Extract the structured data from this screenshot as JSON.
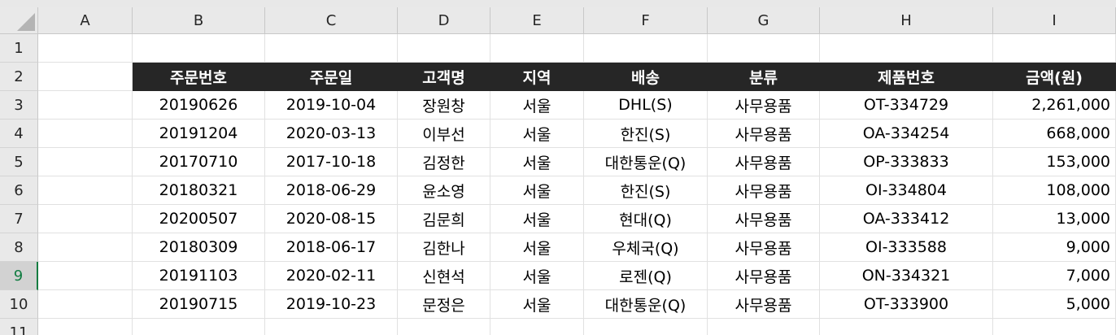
{
  "columns": [
    "A",
    "B",
    "C",
    "D",
    "E",
    "F",
    "G",
    "H",
    "I"
  ],
  "rows": [
    "1",
    "2",
    "3",
    "4",
    "5",
    "6",
    "7",
    "8",
    "9",
    "10",
    "11"
  ],
  "active_row": "9",
  "table": {
    "headers": [
      "주문번호",
      "주문일",
      "고객명",
      "지역",
      "배송",
      "분류",
      "제품번호",
      "금액(원)"
    ],
    "records": [
      [
        "20190626",
        "2019-10-04",
        "장원창",
        "서울",
        "DHL(S)",
        "사무용품",
        "OT-334729",
        "2,261,000"
      ],
      [
        "20191204",
        "2020-03-13",
        "이부선",
        "서울",
        "한진(S)",
        "사무용품",
        "OA-334254",
        "668,000"
      ],
      [
        "20170710",
        "2017-10-18",
        "김정한",
        "서울",
        "대한통운(Q)",
        "사무용품",
        "OP-333833",
        "153,000"
      ],
      [
        "20180321",
        "2018-06-29",
        "윤소영",
        "서울",
        "한진(S)",
        "사무용품",
        "OI-334804",
        "108,000"
      ],
      [
        "20200507",
        "2020-08-15",
        "김문희",
        "서울",
        "현대(Q)",
        "사무용품",
        "OA-333412",
        "13,000"
      ],
      [
        "20180309",
        "2018-06-17",
        "김한나",
        "서울",
        "우체국(Q)",
        "사무용품",
        "OI-333588",
        "9,000"
      ],
      [
        "20191103",
        "2020-02-11",
        "신현석",
        "서울",
        "로젠(Q)",
        "사무용품",
        "ON-334321",
        "7,000"
      ],
      [
        "20190715",
        "2019-10-23",
        "문정은",
        "서울",
        "대한통운(Q)",
        "사무용품",
        "OT-333900",
        "5,000"
      ]
    ]
  },
  "colors": {
    "header_fill": "#262626",
    "header_text": "#ffffff",
    "active_row_accent": "#107c41"
  }
}
